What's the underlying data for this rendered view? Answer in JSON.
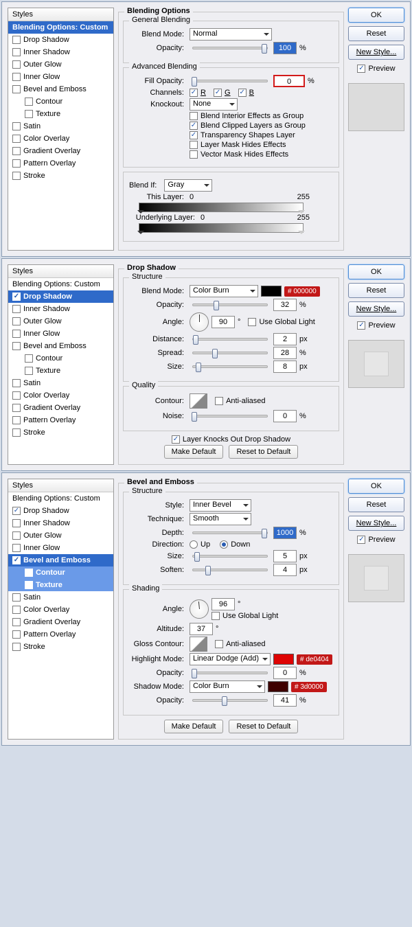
{
  "styles_header": "Styles",
  "style_items": [
    "Blending Options: Custom",
    "Drop Shadow",
    "Inner Shadow",
    "Outer Glow",
    "Inner Glow",
    "Bevel and Emboss",
    "Contour",
    "Texture",
    "Satin",
    "Color Overlay",
    "Gradient Overlay",
    "Pattern Overlay",
    "Stroke"
  ],
  "btns": {
    "ok": "OK",
    "reset": "Reset",
    "new_style": "New Style...",
    "preview": "Preview"
  },
  "p1": {
    "title": "Blending Options",
    "gen": {
      "title": "General Blending",
      "blend_mode_l": "Blend Mode:",
      "blend_mode": "Normal",
      "opacity_l": "Opacity:",
      "opacity": "100",
      "pct": "%"
    },
    "adv": {
      "title": "Advanced Blending",
      "fill_l": "Fill Opacity:",
      "fill": "0",
      "pct": "%",
      "ch_l": "Channels:",
      "r": "R",
      "g": "G",
      "b": "B",
      "ko_l": "Knockout:",
      "ko": "None",
      "o1": "Blend Interior Effects as Group",
      "o2": "Blend Clipped Layers as Group",
      "o3": "Transparency Shapes Layer",
      "o4": "Layer Mask Hides Effects",
      "o5": "Vector Mask Hides Effects"
    },
    "bi": {
      "title": "Blend If:",
      "gray": "Gray",
      "this_l": "This Layer:",
      "v0": "0",
      "v255": "255",
      "under_l": "Underlying Layer:"
    }
  },
  "p2": {
    "title": "Drop Shadow",
    "str": {
      "title": "Structure",
      "mode_l": "Blend Mode:",
      "mode": "Color Burn",
      "color": "#000000",
      "badge": "# 000000",
      "op_l": "Opacity:",
      "op": "32",
      "pct": "%",
      "ang_l": "Angle:",
      "ang": "90",
      "deg": "°",
      "ugl": "Use Global Light",
      "dist_l": "Distance:",
      "dist": "2",
      "px": "px",
      "spr_l": "Spread:",
      "spr": "28",
      "sz_l": "Size:",
      "sz": "8"
    },
    "q": {
      "title": "Quality",
      "cont_l": "Contour:",
      "aa": "Anti-aliased",
      "noise_l": "Noise:",
      "noise": "0",
      "pct": "%"
    },
    "knock": "Layer Knocks Out Drop Shadow",
    "mk": "Make Default",
    "rst": "Reset to Default"
  },
  "p3": {
    "title": "Bevel and Emboss",
    "str": {
      "title": "Structure",
      "style_l": "Style:",
      "style": "Inner Bevel",
      "tech_l": "Technique:",
      "tech": "Smooth",
      "depth_l": "Depth:",
      "depth": "1000",
      "pct": "%",
      "dir_l": "Direction:",
      "up": "Up",
      "down": "Down",
      "sz_l": "Size:",
      "sz": "5",
      "px": "px",
      "soft_l": "Soften:",
      "soft": "4"
    },
    "sh": {
      "title": "Shading",
      "ang_l": "Angle:",
      "ang": "96",
      "deg": "°",
      "ugl": "Use Global Light",
      "alt_l": "Altitude:",
      "alt": "37",
      "gc_l": "Gloss Contour:",
      "aa": "Anti-aliased",
      "hm_l": "Highlight Mode:",
      "hm": "Linear Dodge (Add)",
      "hcol": "#de0404",
      "hbadge": "# de0404",
      "hop_l": "Opacity:",
      "hop": "0",
      "pct": "%",
      "sm_l": "Shadow Mode:",
      "sm": "Color Burn",
      "scol": "#3d0000",
      "sbadge": "# 3d0000",
      "sop_l": "Opacity:",
      "sop": "41"
    },
    "mk": "Make Default",
    "rst": "Reset to Default"
  }
}
